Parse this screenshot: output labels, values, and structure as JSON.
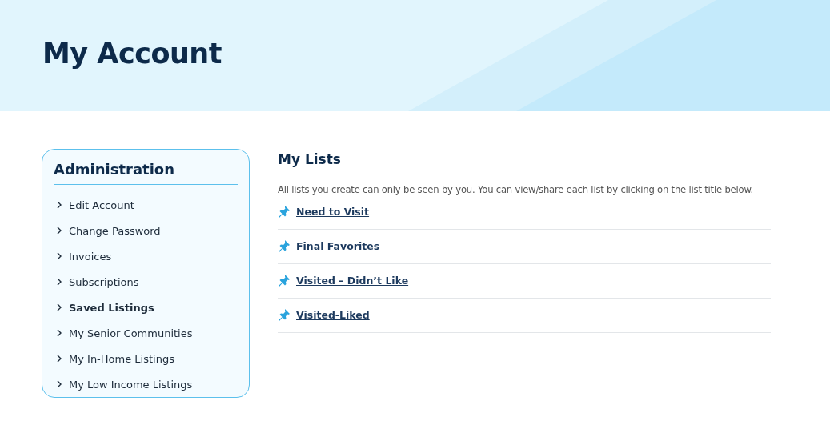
{
  "header": {
    "title": "My Account"
  },
  "sidebar": {
    "title": "Administration",
    "items": [
      {
        "label": "Edit Account",
        "selected": false
      },
      {
        "label": "Change Password",
        "selected": false
      },
      {
        "label": "Invoices",
        "selected": false
      },
      {
        "label": "Subscriptions",
        "selected": false
      },
      {
        "label": "Saved Listings",
        "selected": true
      },
      {
        "label": "My Senior Communities",
        "selected": false
      },
      {
        "label": "My In-Home Listings",
        "selected": false
      },
      {
        "label": "My Low Income Listings",
        "selected": false
      }
    ]
  },
  "main": {
    "title": "My Lists",
    "description": "All lists you create can only be seen by you. You can view/share each list by clicking on the list title below.",
    "lists": [
      {
        "label": "Need to Visit"
      },
      {
        "label": "Final Favorites"
      },
      {
        "label": "Visited – Didn’t Like"
      },
      {
        "label": "Visited-Liked"
      }
    ]
  }
}
